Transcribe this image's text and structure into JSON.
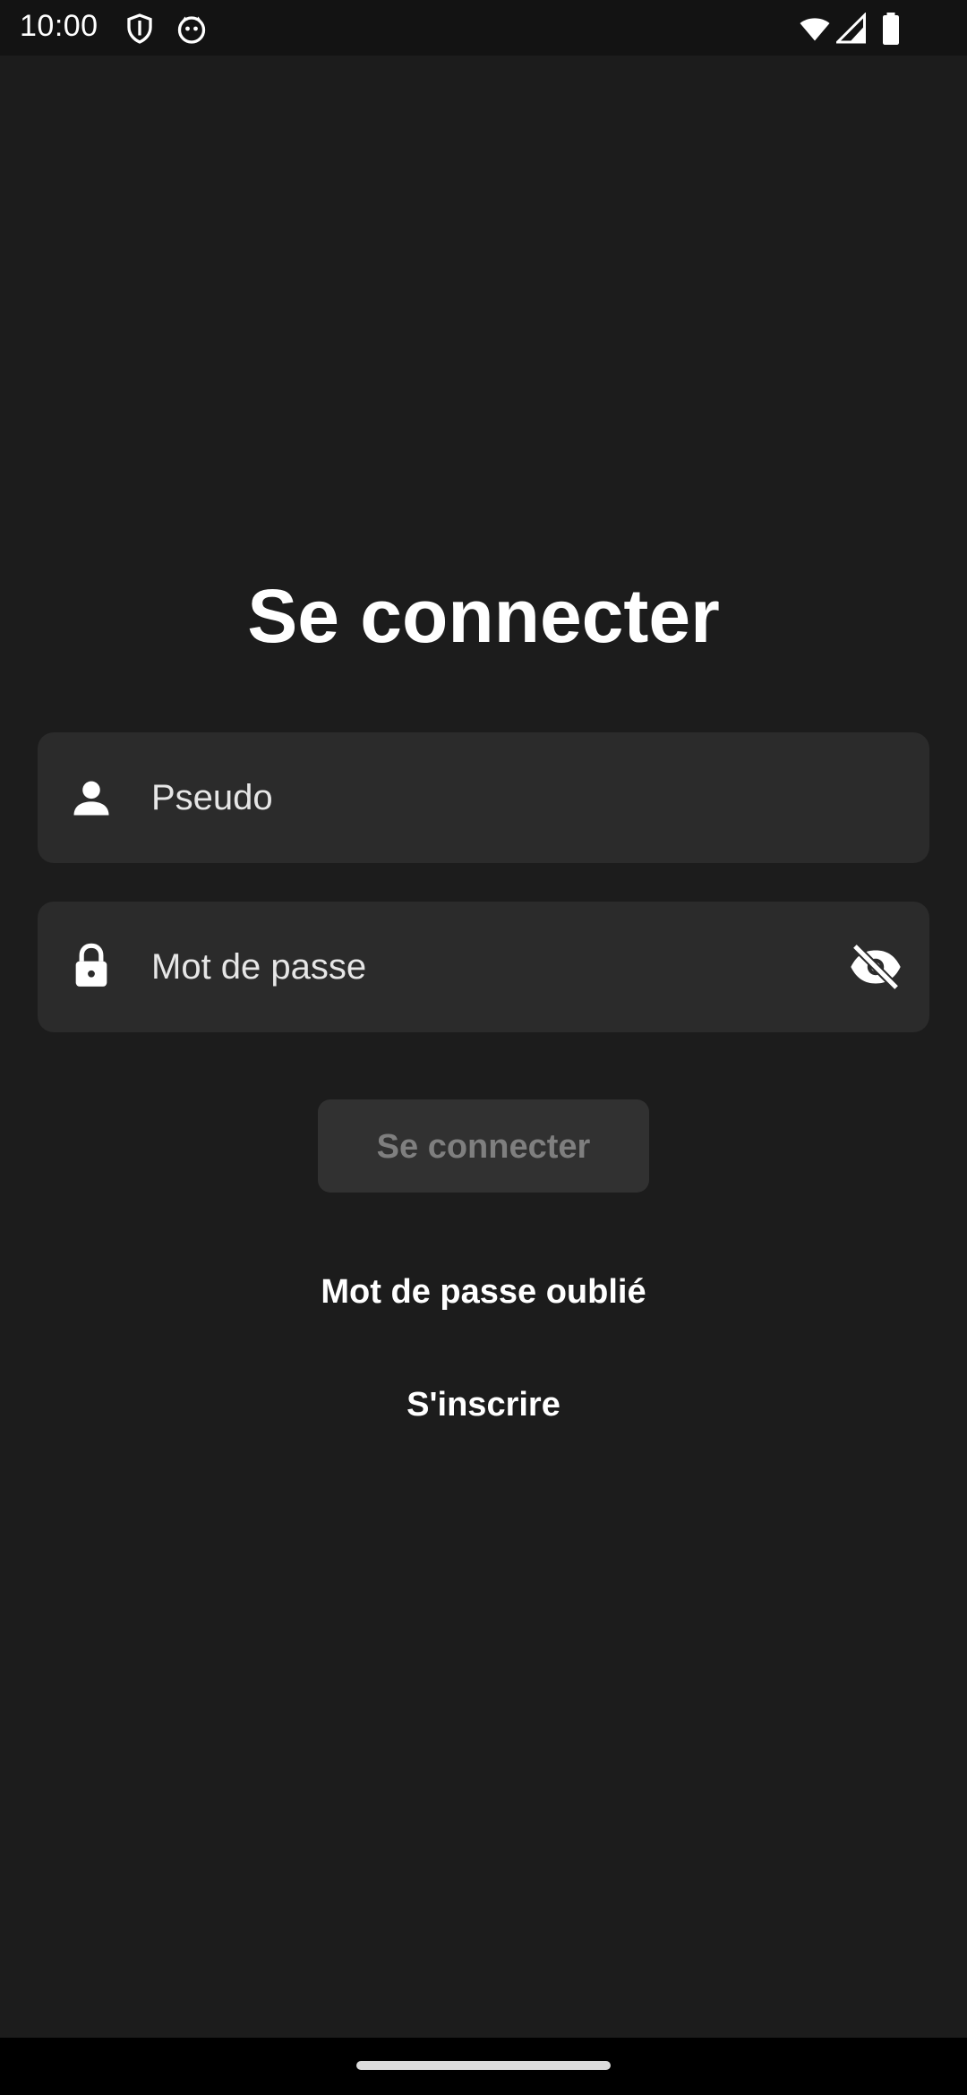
{
  "status_bar": {
    "time": "10:00",
    "icons": [
      "shield-icon",
      "cat-face-icon",
      "wifi-icon",
      "cellular-signal-icon",
      "battery-icon"
    ]
  },
  "login": {
    "title": "Se connecter",
    "username_placeholder": "Pseudo",
    "username_icon": "person-icon",
    "password_placeholder": "Mot de passe",
    "password_icon": "lock-icon",
    "password_toggle_icon": "eye-off-icon",
    "submit_label": "Se connecter",
    "forgot_password_label": "Mot de passe oublié",
    "register_label": "S'inscrire"
  },
  "colors": {
    "background": "#1c1c1c",
    "field_background": "#2b2b2b",
    "button_background": "#313131",
    "button_text_disabled": "#7f7f7f",
    "text": "#ffffff"
  }
}
